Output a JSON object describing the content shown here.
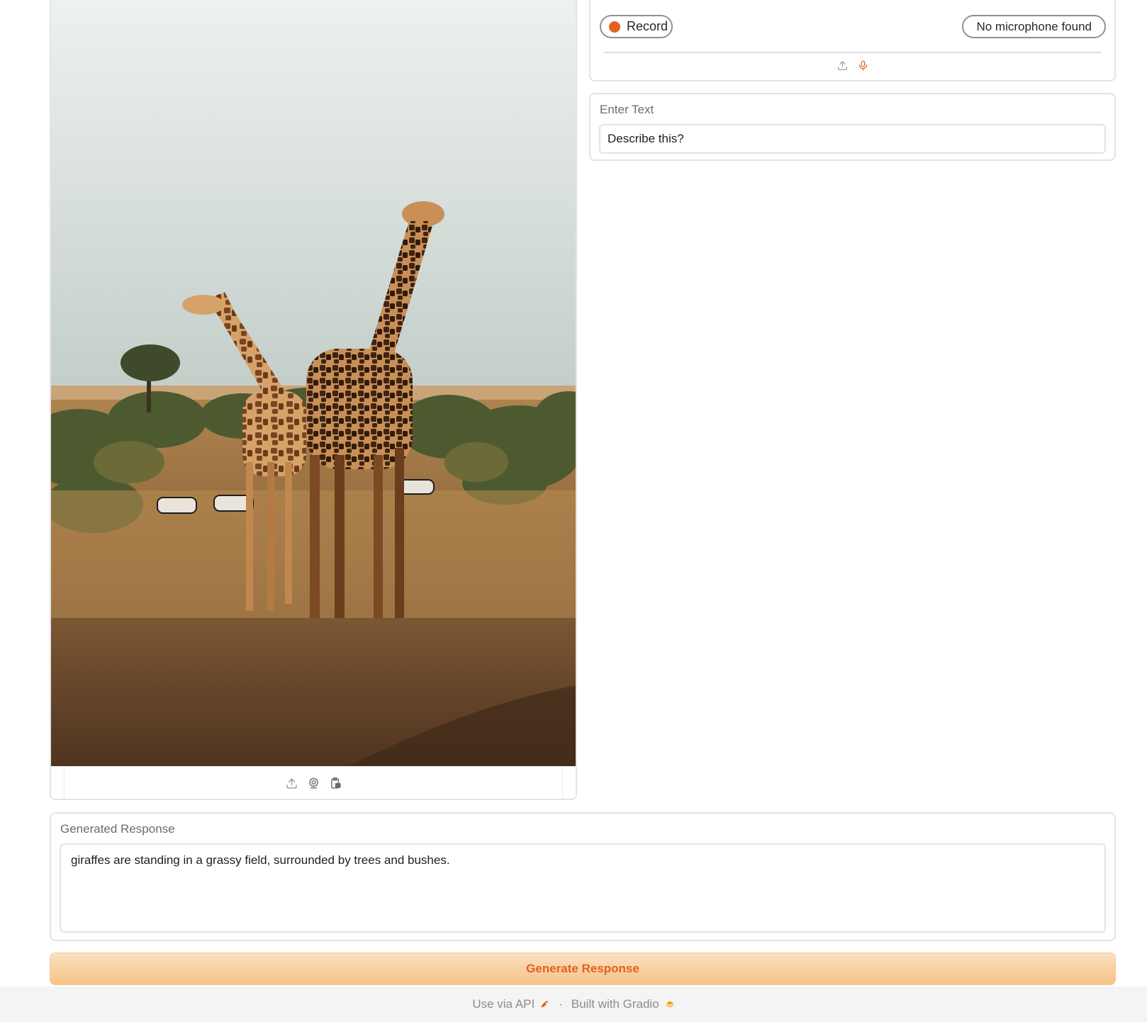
{
  "image_input": {
    "toolbar_icons": [
      "upload-icon",
      "webcam-icon",
      "clipboard-icon"
    ]
  },
  "audio_input": {
    "record_label": "Record",
    "microphone_label": "No microphone found",
    "source_icons": [
      "upload-icon",
      "microphone-icon"
    ],
    "accent_color": "#e0621f"
  },
  "text_input": {
    "label": "Enter Text",
    "value": "Describe this?"
  },
  "response": {
    "label": "Generated Response",
    "value": "giraffes are standing in a grassy field, surrounded by trees and bushes."
  },
  "generate_button": {
    "label": "Generate Response"
  },
  "footer": {
    "api_link": "Use via API",
    "separator": "·",
    "built_with": "Built with Gradio"
  },
  "colors": {
    "accent": "#e0621f",
    "button_gradient_top": "#fbe1c1",
    "button_gradient_bottom": "#f6c287",
    "border": "#e4e4e7"
  }
}
